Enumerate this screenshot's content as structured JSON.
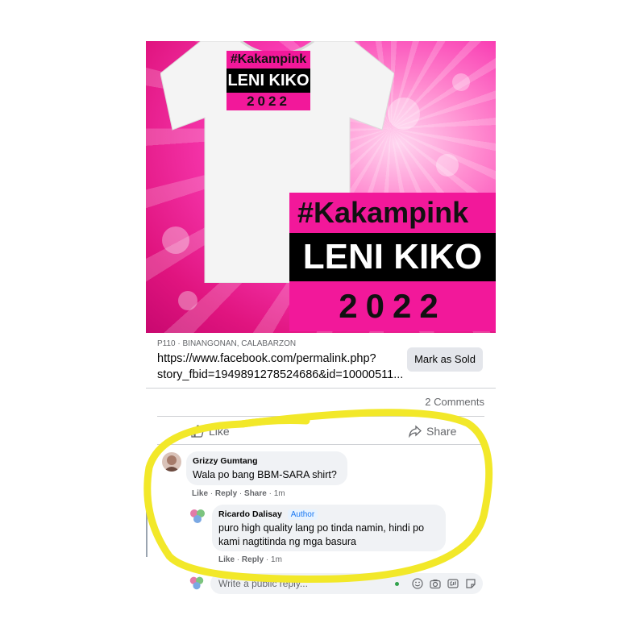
{
  "image": {
    "small_print": {
      "hashtag": "#Kakampink",
      "names": "LENI KIKO",
      "year": "2022"
    },
    "big_print": {
      "hashtag": "#Kakampink",
      "names": "LENI KIKO",
      "year": "2022"
    }
  },
  "listing": {
    "meta": "P110 · BINANGONAN, CALABARZON",
    "link_line1": "https://www.facebook.com/permalink.php?",
    "link_line2": "story_fbid=1949891278524686&id=10000511...",
    "mark_sold_label": "Mark as Sold"
  },
  "stats": {
    "comments": "2 Comments"
  },
  "actions": {
    "like": "Like",
    "share": "Share"
  },
  "comments": [
    {
      "author": "Grizzy Gumtang",
      "text": "Wala po bang BBM-SARA shirt?",
      "actions": [
        "Like",
        "Reply",
        "Share"
      ],
      "time": "1m"
    },
    {
      "author": "Ricardo Dalisay",
      "badge": "Author",
      "text_line1": "puro high quality lang po tinda namin, hindi po",
      "text_line2": "kami nagtitinda ng mga basura",
      "actions": [
        "Like",
        "Reply"
      ],
      "time": "1m"
    }
  ],
  "reply_box": {
    "placeholder": "Write a public reply..."
  },
  "colors": {
    "highlight": "#f2e829",
    "brand_pink": "#f2189a",
    "fb_blue": "#1877f2"
  }
}
